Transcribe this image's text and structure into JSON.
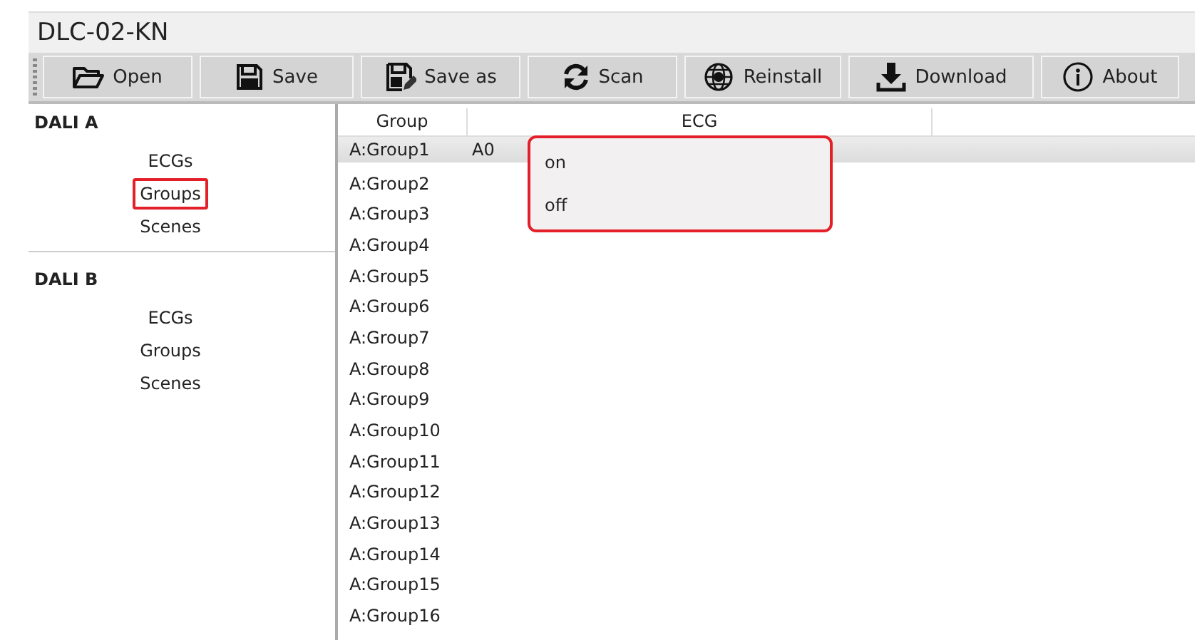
{
  "window": {
    "title": "DLC-02-KN"
  },
  "toolbar": [
    {
      "kind": "open",
      "label": "Open"
    },
    {
      "kind": "save",
      "label": "Save"
    },
    {
      "kind": "saveas",
      "label": "Save as"
    },
    {
      "kind": "scan",
      "label": "Scan"
    },
    {
      "kind": "reinstall",
      "label": "Reinstall"
    },
    {
      "kind": "download",
      "label": "Download"
    },
    {
      "kind": "about",
      "label": "About"
    }
  ],
  "sidebar": [
    {
      "title": "DALI A",
      "items": [
        {
          "label": "ECGs",
          "highlighted": false
        },
        {
          "label": "Groups",
          "highlighted": true
        },
        {
          "label": "Scenes",
          "highlighted": false
        }
      ]
    },
    {
      "title": "DALI B",
      "items": [
        {
          "label": "ECGs",
          "highlighted": false
        },
        {
          "label": "Groups",
          "highlighted": false
        },
        {
          "label": "Scenes",
          "highlighted": false
        }
      ]
    }
  ],
  "table": {
    "columns": [
      "Group",
      "ECG"
    ],
    "rows": [
      {
        "group": "A:Group1",
        "ecg": "A0",
        "selected": true
      },
      {
        "group": "A:Group2",
        "selected": false
      },
      {
        "group": "A:Group3",
        "selected": false
      },
      {
        "group": "A:Group4",
        "selected": false
      },
      {
        "group": "A:Group5",
        "selected": false
      },
      {
        "group": "A:Group6",
        "selected": false
      },
      {
        "group": "A:Group7",
        "selected": false
      },
      {
        "group": "A:Group8",
        "selected": false
      },
      {
        "group": "A:Group9",
        "selected": false
      },
      {
        "group": "A:Group10",
        "selected": false
      },
      {
        "group": "A:Group11",
        "selected": false
      },
      {
        "group": "A:Group12",
        "selected": false
      },
      {
        "group": "A:Group13",
        "selected": false
      },
      {
        "group": "A:Group14",
        "selected": false
      },
      {
        "group": "A:Group15",
        "selected": false
      },
      {
        "group": "A:Group16",
        "selected": false
      }
    ]
  },
  "context_menu": {
    "highlighted": true,
    "items": [
      "on",
      "off"
    ]
  }
}
